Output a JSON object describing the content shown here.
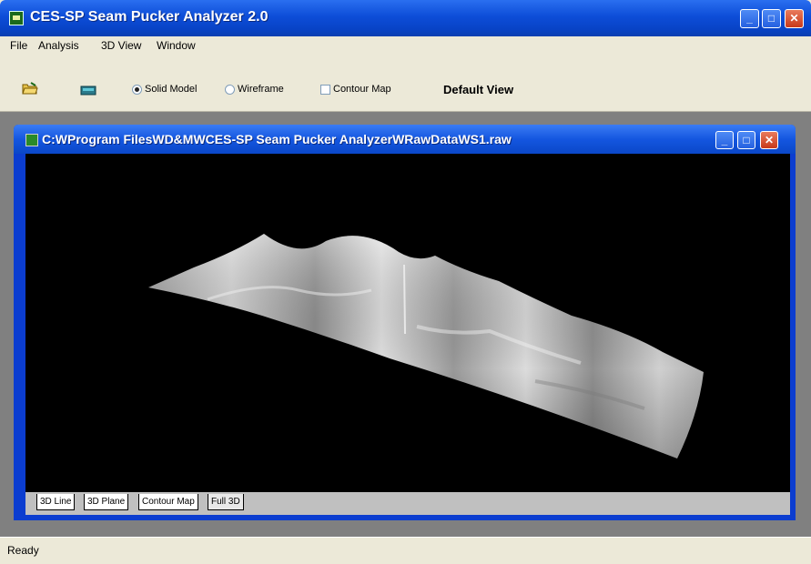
{
  "app": {
    "title": "CES-SP Seam Pucker Analyzer 2.0"
  },
  "window_buttons": {
    "minimize": "_",
    "maximize": "□",
    "close": "✕"
  },
  "menu": [
    "File",
    "Analysis",
    "3D View",
    "Window"
  ],
  "toolbar": {
    "open_icon": "open-folder-icon",
    "device_icon": "scanner-icon",
    "radio_solid": "Solid Model",
    "radio_wireframe": "Wireframe",
    "check_contour": "Contour Map",
    "solid_selected": true,
    "wireframe_selected": false,
    "contour_checked": false,
    "default_view": "Default View"
  },
  "child": {
    "title": "C:WProgram FilesWD&MWCES-SP Seam Pucker AnalyzerWRawDataWS1.raw"
  },
  "tabs": [
    "3D Line",
    "3D Plane",
    "Contour Map",
    "Full 3D"
  ],
  "active_tab": "Full 3D",
  "status": {
    "text": "Ready"
  },
  "colors": {
    "titlebar": "#0d4dd8",
    "viewport_bg": "#000000",
    "surface": "#c8c8c8"
  }
}
